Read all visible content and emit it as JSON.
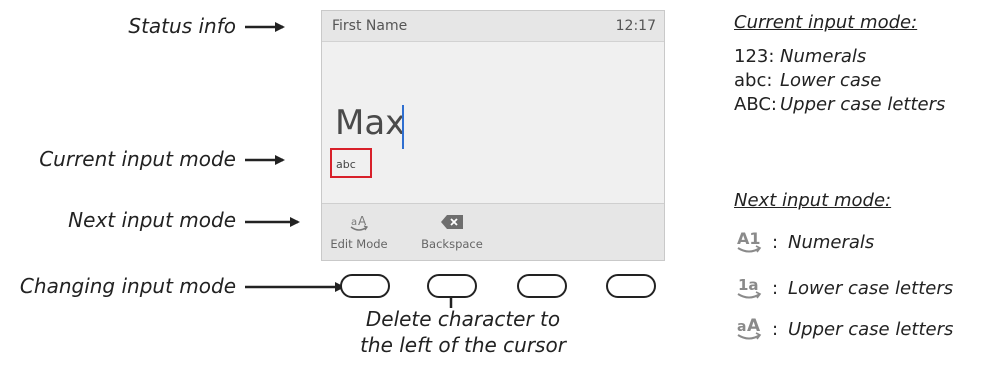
{
  "callouts": {
    "status_info": "Status info",
    "current_input_mode": "Current input mode",
    "next_input_mode": "Next input mode",
    "changing_input_mode": "Changing input mode",
    "delete_character_line1": "Delete character to",
    "delete_character_line2": "the left of the cursor"
  },
  "screen": {
    "field_label": "First Name",
    "time": "12:17",
    "input_value": "Max",
    "current_mode": "abc",
    "softkeys": [
      {
        "label": "Edit Mode",
        "icon": "mode-aA-icon"
      },
      {
        "label": "Backspace",
        "icon": "backspace-icon"
      }
    ]
  },
  "current_modes": {
    "heading": "Current input mode:",
    "items": [
      {
        "key": "123:",
        "desc": "Numerals"
      },
      {
        "key": "abc:",
        "desc": "Lower case"
      },
      {
        "key": "ABC:",
        "desc": "Upper case letters"
      }
    ]
  },
  "next_modes": {
    "heading": "Next input mode:",
    "items": [
      {
        "glyph": "A1",
        "icon": "mode-A1-icon",
        "desc": "Numerals"
      },
      {
        "glyph": "1a",
        "icon": "mode-1a-icon",
        "desc": "Lower case letters"
      },
      {
        "glyph": "aA",
        "icon": "mode-aA-icon",
        "desc": "Upper case letters"
      }
    ],
    "separator": ":"
  },
  "colors": {
    "highlight": "#d8202a",
    "cursor": "#2f6fd0",
    "glyph": "#8a8a8a"
  }
}
